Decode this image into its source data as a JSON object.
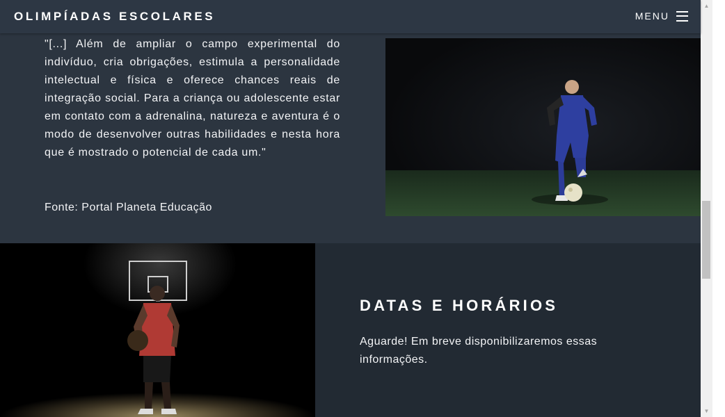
{
  "navbar": {
    "brand": "OLIMPÍADAS ESCOLARES",
    "menu_label": "MENU"
  },
  "quote_section": {
    "quote": "\"[...] Além de ampliar o campo experimental do indivíduo, cria obrigações, estimula a personalidade intelectual e física e oferece chances reais de integração social. Para a criança ou adolescente estar em contato com a adrenalina, natureza e aventura é o modo de desenvolver outras habilidades e nesta hora que é mostrado o potencial de cada um.\"",
    "source": "Fonte: Portal Planeta Educação"
  },
  "dates_section": {
    "title": "DATAS E HORÁRIOS",
    "text": "Aguarde! Em breve disponibilizaremos essas informações."
  },
  "colors": {
    "navbar_bg": "#2d3744",
    "section_bg": "#2c3540",
    "dark_section_bg": "#222a33",
    "text": "#ffffff"
  },
  "icons": {
    "menu": "hamburger-icon",
    "scroll_up": "arrow-up-icon",
    "scroll_down": "arrow-down-icon"
  }
}
